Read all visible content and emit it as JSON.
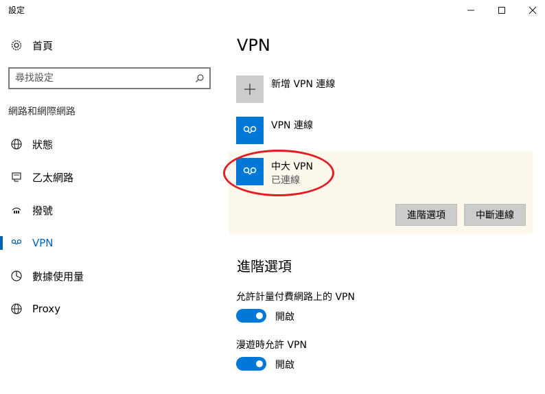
{
  "window": {
    "title": "設定"
  },
  "sidebar": {
    "home_label": "首頁",
    "search_placeholder": "尋找設定",
    "section_label": "網路和網際網路",
    "items": [
      {
        "label": "狀態",
        "icon": "globe-icon"
      },
      {
        "label": "乙太網路",
        "icon": "ethernet-icon"
      },
      {
        "label": "撥號",
        "icon": "dialup-icon"
      },
      {
        "label": "VPN",
        "icon": "vpn-icon",
        "active": true
      },
      {
        "label": "數據使用量",
        "icon": "data-usage-icon"
      },
      {
        "label": "Proxy",
        "icon": "globe-icon"
      }
    ]
  },
  "main": {
    "title": "VPN",
    "add_connection_label": "新增 VPN 連線",
    "connections": [
      {
        "name": "VPN 連線",
        "status": ""
      },
      {
        "name": "中大 VPN",
        "status": "已連線",
        "selected": true
      }
    ],
    "buttons": {
      "advanced": "進階選項",
      "disconnect": "中斷連線"
    },
    "advanced": {
      "heading": "進階選項",
      "settings": [
        {
          "label": "允許計量付費網路上的 VPN",
          "toggle_text": "開啟",
          "on": true
        },
        {
          "label": "漫遊時允許 VPN",
          "toggle_text": "開啟",
          "on": true
        }
      ]
    }
  },
  "colors": {
    "accent": "#0078d7",
    "accent_dark": "#0063b1",
    "selected_bg": "#fcf8ec",
    "annotation": "#e31b23"
  }
}
